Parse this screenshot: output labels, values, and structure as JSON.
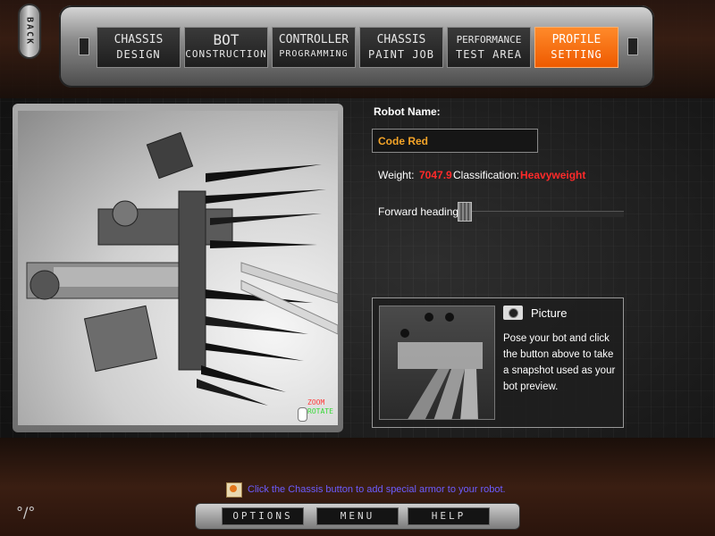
{
  "back_label": "BACK",
  "tabs": [
    {
      "line1": "CHASSIS",
      "line2": "DESIGN"
    },
    {
      "line1": "BOT",
      "line2": "CONSTRUCTION"
    },
    {
      "line1": "CONTROLLER",
      "line2": "PROGRAMMING"
    },
    {
      "line1": "CHASSIS",
      "line2": "PAINT JOB"
    },
    {
      "line1": "PERFORMANCE",
      "line2": "TEST AREA"
    },
    {
      "line1": "PROFILE",
      "line2": "SETTING"
    }
  ],
  "active_tab_color": "#f06a10",
  "viewport": {
    "zoom_label": "ZOOM",
    "rotate_label": "ROTATE",
    "zoom_color": "#ff3b3b",
    "rotate_color": "#37d837"
  },
  "robot": {
    "name_label": "Robot Name:",
    "name_value": "Code Red",
    "weight_label": "Weight:",
    "weight_value": "7047.9",
    "class_label": "Classification:",
    "class_value": "Heavyweight",
    "heading_label": "Forward heading:"
  },
  "picture": {
    "icon": "camera-icon",
    "title": "Picture",
    "description": "Pose your bot and click the button above to take a snapshot used as your bot preview."
  },
  "tip": {
    "icon": "tips-icon",
    "text": "Click the Chassis button to add special armor to your robot."
  },
  "bottom": {
    "options": "OPTIONS",
    "menu": "MENU",
    "help": "HELP"
  },
  "corner_glyph": "°/°"
}
